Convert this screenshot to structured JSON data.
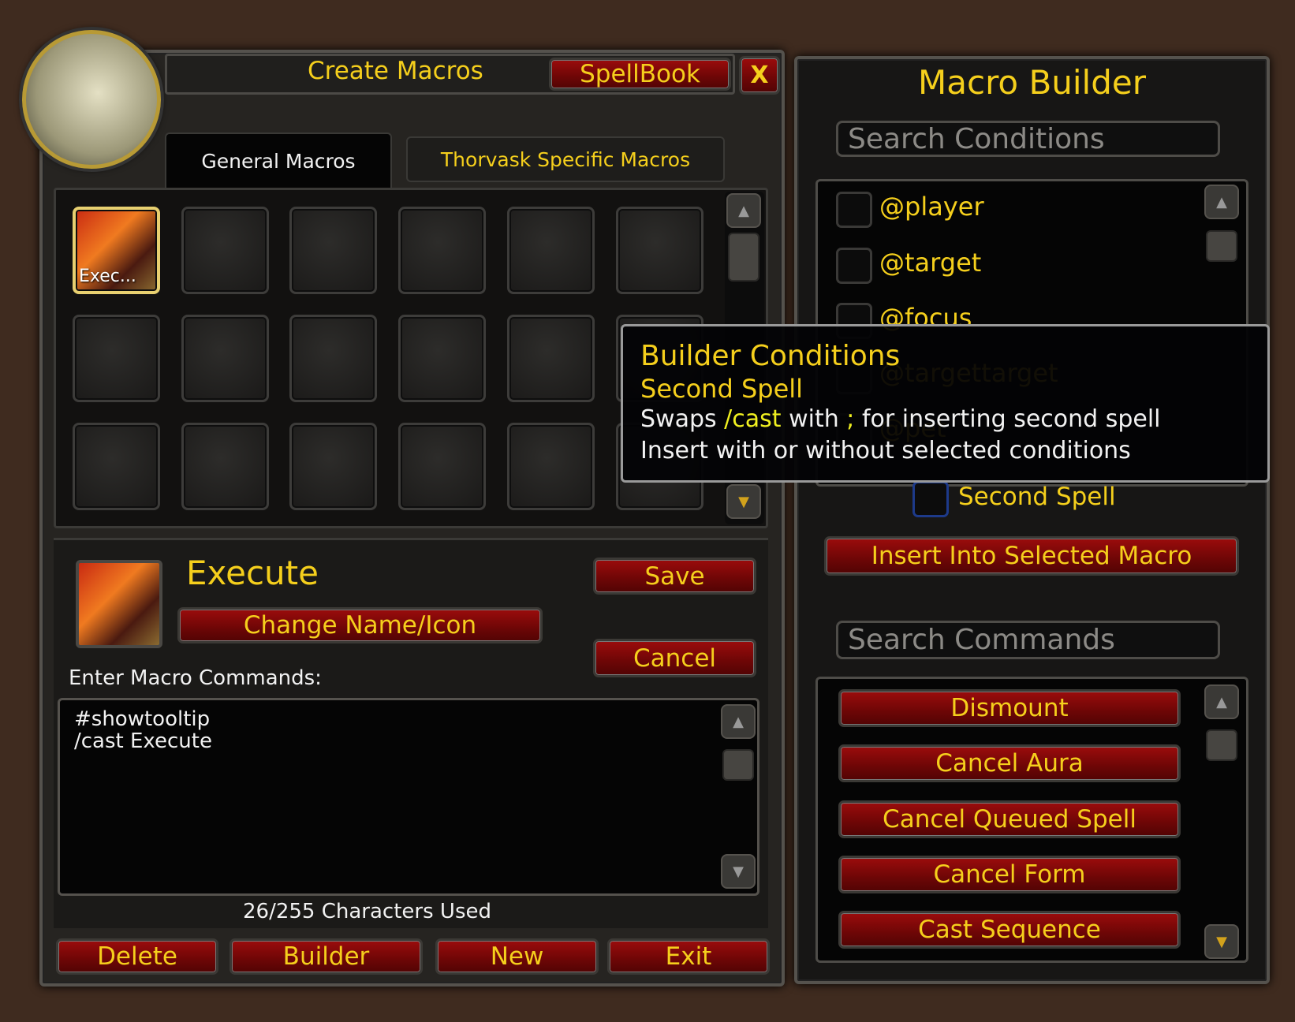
{
  "window": {
    "title": "Create Macros",
    "spellbook_label": "SpellBook",
    "close_label": "X"
  },
  "tabs": [
    {
      "label": "General Macros",
      "active": true
    },
    {
      "label": "Thorvask Specific Macros",
      "active": false
    }
  ],
  "macro_slots": [
    {
      "label": "Exec...",
      "filled": true
    }
  ],
  "selected_macro": {
    "name": "Execute",
    "change_label": "Change Name/Icon",
    "save_label": "Save",
    "cancel_label": "Cancel"
  },
  "editor": {
    "label": "Enter Macro Commands:",
    "lines": [
      "#showtooltip",
      "/cast Execute"
    ],
    "char_count": "26/255 Characters Used"
  },
  "bottom_buttons": [
    "Delete",
    "Builder",
    "New",
    "Exit"
  ],
  "builder": {
    "title": "Macro Builder",
    "search_conditions_placeholder": "Search Conditions",
    "conditions": [
      "@player",
      "@target",
      "@focus",
      "@targettarget",
      "@pet"
    ],
    "second_spell_label": "Second Spell",
    "insert_label": "Insert Into Selected Macro",
    "search_commands_placeholder": "Search Commands",
    "commands": [
      "Dismount",
      "Cancel Aura",
      "Cancel Queued Spell",
      "Cancel Form",
      "Cast Sequence"
    ]
  },
  "tooltip": {
    "title": "Builder Conditions",
    "subtitle": "Second Spell",
    "line1_a": "Swaps ",
    "line1_b": "/cast",
    "line1_c": " with ",
    "line1_d": ";",
    "line1_e": " for inserting second spell",
    "line2": "Insert with or without selected conditions"
  },
  "colors": {
    "gold": "#f5cf1c",
    "button_red": "#8b0a0a",
    "background": "#3f2b1f",
    "checkbox_selected": "#1d3a8a"
  }
}
